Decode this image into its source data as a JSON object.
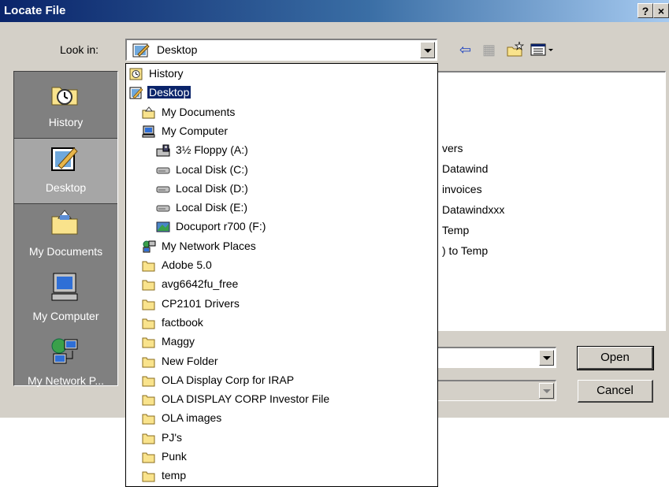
{
  "window": {
    "title": "Locate File",
    "help_label": "?",
    "close_label": "×"
  },
  "lookin": {
    "label": "Look in:",
    "value": "Desktop"
  },
  "places": [
    {
      "label": "History",
      "icon": "history-icon"
    },
    {
      "label": "Desktop",
      "icon": "desktop-icon",
      "active": true
    },
    {
      "label": "My Documents",
      "icon": "my-documents-icon"
    },
    {
      "label": "My Computer",
      "icon": "my-computer-icon"
    },
    {
      "label": "My Network P...",
      "icon": "network-places-icon"
    }
  ],
  "file_list_partial": [
    "vers",
    "Datawind",
    "invoices",
    "Datawindxxx",
    "Temp",
    ") to Temp"
  ],
  "dropdown": [
    {
      "label": "History",
      "icon": "history-icon",
      "indent": 0
    },
    {
      "label": "Desktop",
      "icon": "desktop-icon",
      "indent": 0,
      "selected": true
    },
    {
      "label": "My Documents",
      "icon": "my-documents-icon",
      "indent": 1
    },
    {
      "label": "My Computer",
      "icon": "my-computer-icon",
      "indent": 1
    },
    {
      "label": "3½ Floppy (A:)",
      "icon": "floppy-icon",
      "indent": 2
    },
    {
      "label": "Local Disk (C:)",
      "icon": "drive-icon",
      "indent": 2
    },
    {
      "label": "Local Disk (D:)",
      "icon": "drive-icon",
      "indent": 2
    },
    {
      "label": "Local Disk (E:)",
      "icon": "drive-icon",
      "indent": 2
    },
    {
      "label": "Docuport r700 (F:)",
      "icon": "scanner-drive-icon",
      "indent": 2
    },
    {
      "label": "My Network Places",
      "icon": "network-places-icon",
      "indent": 1
    },
    {
      "label": "Adobe 5.0",
      "icon": "folder-icon",
      "indent": 1
    },
    {
      "label": "avg6642fu_free",
      "icon": "folder-icon",
      "indent": 1
    },
    {
      "label": "CP2101 Drivers",
      "icon": "folder-icon",
      "indent": 1
    },
    {
      "label": "factbook",
      "icon": "folder-icon",
      "indent": 1
    },
    {
      "label": "Maggy",
      "icon": "folder-icon",
      "indent": 1
    },
    {
      "label": "New Folder",
      "icon": "folder-icon",
      "indent": 1
    },
    {
      "label": "OLA Display Corp for IRAP",
      "icon": "folder-icon",
      "indent": 1
    },
    {
      "label": "OLA DISPLAY CORP Investor File",
      "icon": "folder-icon",
      "indent": 1
    },
    {
      "label": "OLA images",
      "icon": "folder-icon",
      "indent": 1
    },
    {
      "label": "PJ's",
      "icon": "folder-icon",
      "indent": 1
    },
    {
      "label": "Punk",
      "icon": "folder-icon",
      "indent": 1
    },
    {
      "label": "temp",
      "icon": "folder-icon",
      "indent": 1
    }
  ],
  "buttons": {
    "open": "Open",
    "cancel": "Cancel"
  },
  "colors": {
    "face": "#d4d0c8",
    "selection": "#0a246a",
    "title_start": "#0a246a",
    "title_end": "#a6caf0"
  }
}
